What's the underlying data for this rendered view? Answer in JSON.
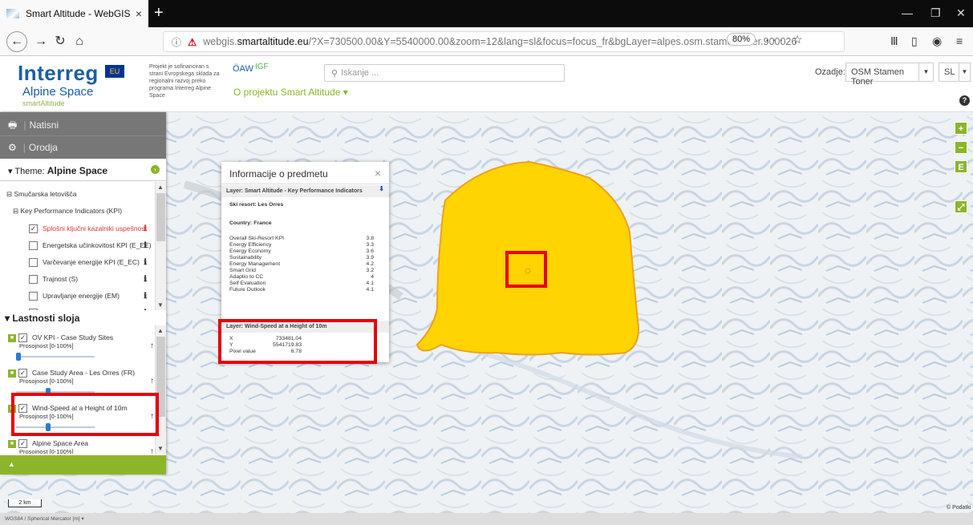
{
  "browser": {
    "tab_title": "Smart Altitude - WebGIS",
    "url_prefix": "webgis.",
    "url_host": "smartaltitude.eu",
    "url_rest": "/?X=730500.00&Y=5540000.00&zoom=12&lang=sl&focus=focus_fr&bgLayer=alpes.osm.stamentoner.900026",
    "zoom": "80%",
    "page_actions": "··· ☆"
  },
  "header": {
    "logo_main": "Interreg",
    "logo_eu": "EU",
    "logo_sub": "Alpine Space",
    "logo_small": "smartAltitude",
    "project_text": "Projekt je sofinanciran s strani Evropskega sklada za regionalni razvoj preko programa Interreg Alpine Space",
    "oaw": "ÖAW",
    "igf": "IGF",
    "about_link": "O projektu Smart Altitude ▾",
    "search_placeholder": "Iskanje ...",
    "background_label": "Ozadje:",
    "background_value": "OSM Stamen Toner",
    "language_value": "SL"
  },
  "sidebar": {
    "print_label": "Natisni",
    "tools_label": "Orodja",
    "theme_prefix": "Theme:",
    "theme_name": "Alpine Space",
    "tree": {
      "group": "Smučarska letovišča",
      "subgroup": "Key Performance Indicators (KPI)",
      "items": [
        {
          "label": "Splošni ključni kazalniki uspešnost",
          "checked": true
        },
        {
          "label": "Energetska učinkovitost KPI (E_EE)",
          "checked": false
        },
        {
          "label": "Varčevanje energije KPI (E_EC)",
          "checked": false
        },
        {
          "label": "Trajnost (S)",
          "checked": false
        },
        {
          "label": "Upravljanje energije (EM)",
          "checked": false
        },
        {
          "label": "Pametno omrežje (SG)",
          "checked": false
        }
      ]
    },
    "props_title": "Lastnosti sloja",
    "props": [
      {
        "label": "OV KPI - Case Study Sites",
        "opacity": "Prosojnost [0-100%]",
        "opacity_value": 0
      },
      {
        "label": "Case Study Area - Les Orres (FR)",
        "opacity": "Prosojnost [0-100%]",
        "opacity_value": 40
      },
      {
        "label": "Wind-Speed at a Height of 10m",
        "opacity": "Prosojnost [0-100%]",
        "opacity_value": 40
      },
      {
        "label": "Alpine Space Area",
        "opacity": "Prosojnost [0-100%]",
        "opacity_value": 40
      }
    ],
    "footer": "▲"
  },
  "popup": {
    "title": "Informacije o predmetu",
    "close": "×",
    "layer1": "Layer: Smart Altitude - Key Performance Indicators",
    "download": "⬇",
    "ski_resort": "Ski resort: Les Orres",
    "country": "Country: France",
    "kpis": [
      {
        "k": "Overall Ski-Resort KPI",
        "v": "3.8"
      },
      {
        "k": "Energy Efficiency",
        "v": "3.3"
      },
      {
        "k": "Energy Economy",
        "v": "3.6"
      },
      {
        "k": "Sustainability",
        "v": "3.9"
      },
      {
        "k": "Energy Management",
        "v": "4.2"
      },
      {
        "k": "Smart Grid",
        "v": "3.2"
      },
      {
        "k": "Adaptio to CC",
        "v": "4"
      },
      {
        "k": "Self Evaluation",
        "v": "4.1"
      },
      {
        "k": "Future Outlook",
        "v": "4.1"
      }
    ],
    "layer2": "Layer: Wind-Speed at a Height of 10m",
    "wind": [
      {
        "k": "X",
        "v": "733481.04"
      },
      {
        "k": "Y",
        "v": "5541719.83"
      },
      {
        "k": "Pixel value",
        "v": "6.78"
      }
    ]
  },
  "map": {
    "scale": "2 km",
    "attribution": "© Podatki",
    "zoom_in": "+",
    "zoom_out": "−",
    "extent": "E",
    "fullscreen": "⤢",
    "polygon_color": "#ffd400",
    "polygon_stroke": "#f0a020"
  },
  "statusbar": {
    "crs": "WGS84 / Spherical Mercator [m]"
  },
  "colors": {
    "accent": "#8cb52a",
    "annotation": "#e8000b"
  }
}
